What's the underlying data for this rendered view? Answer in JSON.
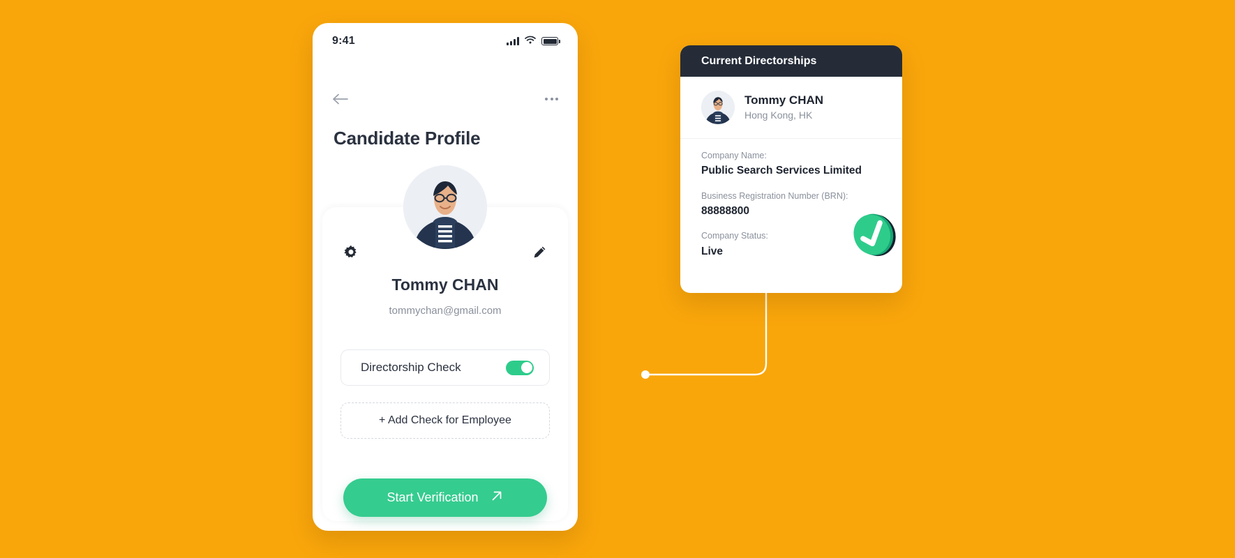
{
  "theme": {
    "background": "#F9A60B",
    "accent_green": "#35CC8F",
    "header_dark": "#252C38",
    "text_dark": "#2b3240",
    "text_muted": "#8a909c"
  },
  "phone": {
    "status_bar": {
      "time": "9:41",
      "signal_icon": "signal-bars-icon",
      "wifi_icon": "wifi-icon",
      "battery_icon": "battery-full-icon"
    },
    "nav": {
      "back_icon": "arrow-left-icon",
      "more_icon": "more-horizontal-icon"
    },
    "title": "Candidate Profile",
    "settings_icon": "gear-icon",
    "edit_icon": "pencil-icon",
    "avatar_icon": "user-avatar-photo",
    "profile": {
      "name": "Tommy CHAN",
      "email": "tommychan@gmail.com"
    },
    "check_row": {
      "label": "Directorship Check",
      "toggle_state": "on"
    },
    "add_check_label": "+ Add Check for Employee",
    "start_button": {
      "label": "Start Verification",
      "icon": "arrow-up-right-icon"
    }
  },
  "directorships": {
    "header": "Current Directorships",
    "person": {
      "avatar_icon": "user-avatar-photo",
      "name": "Tommy CHAN",
      "location": "Hong Kong, HK"
    },
    "fields": [
      {
        "label": "Company Name:",
        "value": "Public Search Services Limited"
      },
      {
        "label": "Business Registration Number (BRN):",
        "value": "88888800"
      },
      {
        "label": "Company Status:",
        "value": "Live"
      }
    ],
    "verified_badge_icon": "check-circle-badge-icon"
  },
  "connector": {
    "icon": "connector-line"
  }
}
